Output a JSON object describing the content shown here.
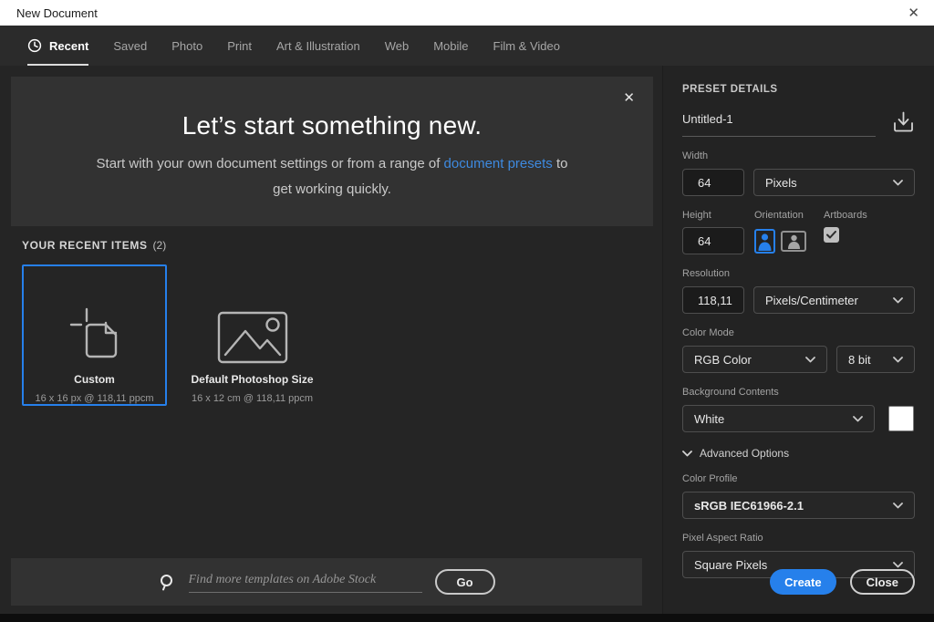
{
  "window": {
    "title": "New Document",
    "close_glyph": "✕"
  },
  "tabs": [
    {
      "label": "Recent",
      "active": true
    },
    {
      "label": "Saved"
    },
    {
      "label": "Photo"
    },
    {
      "label": "Print"
    },
    {
      "label": "Art & Illustration"
    },
    {
      "label": "Web"
    },
    {
      "label": "Mobile"
    },
    {
      "label": "Film & Video"
    }
  ],
  "banner": {
    "heading": "Let’s start something new.",
    "body_before": "Start with your own document settings or from a range of ",
    "link_text": "document presets",
    "body_after": " to get working quickly.",
    "close_glyph": "✕"
  },
  "recent": {
    "heading": "YOUR RECENT ITEMS",
    "count": "(2)",
    "items": [
      {
        "title": "Custom",
        "subtitle": "16 x 16 px @ 118,11 ppcm",
        "selected": true
      },
      {
        "title": "Default Photoshop Size",
        "subtitle": "16 x 12 cm @ 118,11 ppcm",
        "selected": false
      }
    ]
  },
  "search": {
    "placeholder": "Find more templates on Adobe Stock",
    "go_label": "Go"
  },
  "preset": {
    "heading": "PRESET DETAILS",
    "name_value": "Untitled-1",
    "width_label": "Width",
    "width_value": "64",
    "width_unit": "Pixels",
    "height_label": "Height",
    "height_value": "64",
    "orientation_label": "Orientation",
    "artboards_label": "Artboards",
    "artboards_checked": true,
    "resolution_label": "Resolution",
    "resolution_value": "118,11",
    "resolution_unit": "Pixels/Centimeter",
    "color_mode_label": "Color Mode",
    "color_mode_value": "RGB Color",
    "bit_depth_value": "8 bit",
    "background_label": "Background Contents",
    "background_value": "White",
    "advanced_label": "Advanced Options",
    "color_profile_label": "Color Profile",
    "color_profile_value": "sRGB IEC61966-2.1",
    "pixel_aspect_label": "Pixel Aspect Ratio",
    "pixel_aspect_value": "Square Pixels",
    "create_label": "Create",
    "close_label": "Close"
  },
  "colors": {
    "accent_blue": "#2680eb",
    "link_blue": "#3e8ae0",
    "selected_border": "#2680eb",
    "titlebar_bg": "#ffffff",
    "panel_bg": "#232323",
    "banner_bg": "#323232",
    "background_swatch": "#ffffff"
  }
}
